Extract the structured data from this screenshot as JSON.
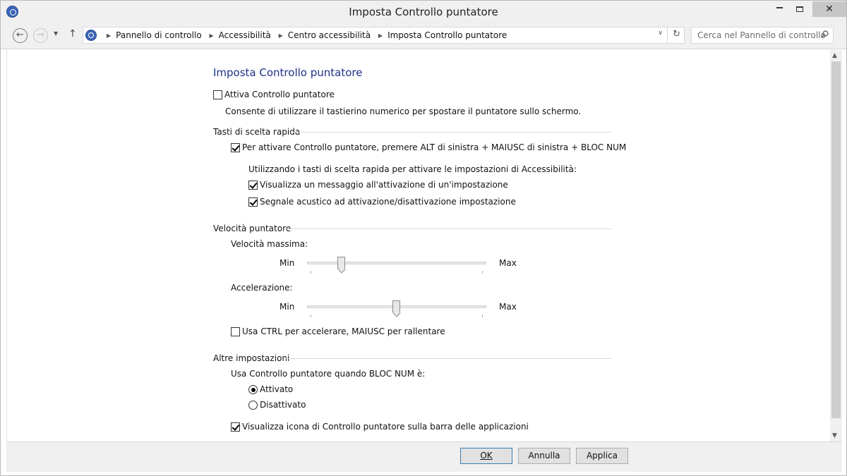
{
  "window": {
    "title": "Imposta Controllo puntatore"
  },
  "nav": {
    "breadcrumb": [
      "Pannello di controllo",
      "Accessibilità",
      "Centro accessibilità",
      "Imposta Controllo puntatore"
    ],
    "search_placeholder": "Cerca nel Pannello di controllo"
  },
  "page": {
    "title": "Imposta Controllo puntatore",
    "enable": {
      "label": "Attiva Controllo puntatore",
      "checked": false,
      "description": "Consente di utilizzare il tastierino numerico per spostare il puntatore sullo schermo."
    },
    "shortcut": {
      "heading": "Tasti di scelta rapida",
      "hotkey_label": "Per attivare Controllo puntatore, premere ALT di sinistra + MAIUSC di sinistra + BLOC NUM",
      "hotkey_checked": true,
      "intro": "Utilizzando i tasti di scelta rapida per attivare le impostazioni di Accessibilità:",
      "warning_label": "Visualizza un messaggio all'attivazione di un'impostazione",
      "warning_checked": true,
      "sound_label": "Segnale acustico ad attivazione/disattivazione impostazione",
      "sound_checked": true
    },
    "speed": {
      "heading": "Velocità puntatore",
      "top_speed_label": "Velocità massima:",
      "top_speed_value": 0.18,
      "acceleration_label": "Accelerazione:",
      "acceleration_value": 0.5,
      "min_label": "Min",
      "max_label": "Max",
      "ctrl_label": "Usa CTRL per accelerare, MAIUSC per rallentare",
      "ctrl_checked": false
    },
    "other": {
      "heading": "Altre impostazioni",
      "numlock_label": "Usa Controllo puntatore quando BLOC NUM è:",
      "on_label": "Attivato",
      "off_label": "Disattivato",
      "selected": "on",
      "taskbar_label": "Visualizza icona di Controllo puntatore sulla barra delle applicazioni",
      "taskbar_checked": true
    }
  },
  "buttons": {
    "ok": "OK",
    "cancel": "Annulla",
    "apply": "Applica"
  }
}
